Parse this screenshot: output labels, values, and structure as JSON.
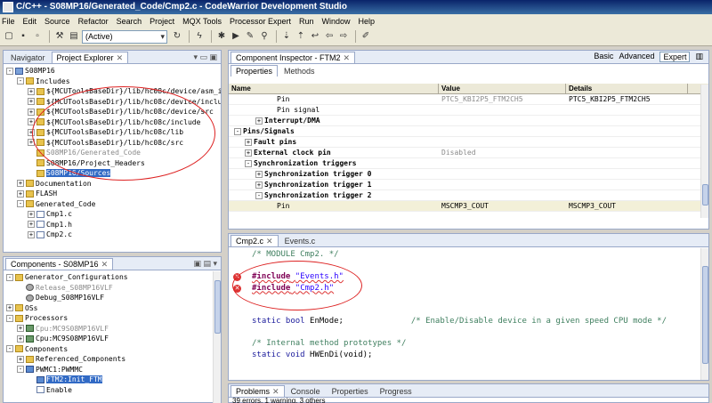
{
  "window": {
    "title": "C/C++ - S08MP16/Generated_Code/Cmp2.c - CodeWarrior Development Studio"
  },
  "menu": [
    "File",
    "Edit",
    "Source",
    "Refactor",
    "Search",
    "Project",
    "MQX Tools",
    "Processor Expert",
    "Run",
    "Window",
    "Help"
  ],
  "toolbar": {
    "config_combo": "(Active)"
  },
  "navigator": {
    "tabs": [
      "Navigator",
      "Project Explorer"
    ],
    "rows": [
      {
        "indent": 0,
        "toggle": "-",
        "icon": "proj",
        "label": "S08MP16"
      },
      {
        "indent": 1,
        "toggle": "-",
        "icon": "folder",
        "label": "Includes"
      },
      {
        "indent": 2,
        "toggle": "+",
        "icon": "folder",
        "label": "${MCUToolsBaseDir}/lib/hc08c/device/asm_in"
      },
      {
        "indent": 2,
        "toggle": "+",
        "icon": "folder",
        "label": "${MCUToolsBaseDir}/lib/hc08c/device/includ"
      },
      {
        "indent": 2,
        "toggle": "+",
        "icon": "folder",
        "label": "${MCUToolsBaseDir}/lib/hc08c/device/src"
      },
      {
        "indent": 2,
        "toggle": "+",
        "icon": "folder",
        "label": "${MCUToolsBaseDir}/lib/hc08c/include"
      },
      {
        "indent": 2,
        "toggle": "+",
        "icon": "folder",
        "label": "${MCUToolsBaseDir}/lib/hc08c/lib"
      },
      {
        "indent": 2,
        "toggle": "+",
        "icon": "folder",
        "label": "${MCUToolsBaseDir}/lib/hc08c/src"
      },
      {
        "indent": 2,
        "toggle": "",
        "icon": "folder",
        "label": "S08MP16/Generated_Code",
        "grey": true
      },
      {
        "indent": 2,
        "toggle": "",
        "icon": "folder",
        "label": "S08MP16/Project_Headers"
      },
      {
        "indent": 2,
        "toggle": "",
        "icon": "folder",
        "label": "S08MP16/Sources",
        "selected": true
      },
      {
        "indent": 1,
        "toggle": "+",
        "icon": "folder",
        "label": "Documentation"
      },
      {
        "indent": 1,
        "toggle": "+",
        "icon": "folder",
        "label": "FLASH"
      },
      {
        "indent": 1,
        "toggle": "-",
        "icon": "folder",
        "label": "Generated_Code"
      },
      {
        "indent": 2,
        "toggle": "+",
        "icon": "file",
        "label": "Cmp1.c"
      },
      {
        "indent": 2,
        "toggle": "+",
        "icon": "file",
        "label": "Cmp1.h"
      },
      {
        "indent": 2,
        "toggle": "+",
        "icon": "file",
        "label": "Cmp2.c"
      }
    ]
  },
  "components": {
    "tab": "Components - S08MP16",
    "rows": [
      {
        "indent": 0,
        "toggle": "-",
        "icon": "folder",
        "label": "Generator_Configurations"
      },
      {
        "indent": 1,
        "toggle": "",
        "icon": "gear",
        "label": "Release_S08MP16VLF",
        "grey": true
      },
      {
        "indent": 1,
        "toggle": "",
        "icon": "gear",
        "label": "Debug_S08MP16VLF"
      },
      {
        "indent": 0,
        "toggle": "+",
        "icon": "folder",
        "label": "OSs"
      },
      {
        "indent": 0,
        "toggle": "-",
        "icon": "folder",
        "label": "Processors"
      },
      {
        "indent": 1,
        "toggle": "+",
        "icon": "cpu",
        "label": "Cpu:MC9S08MP16VLF",
        "grey": true
      },
      {
        "indent": 1,
        "toggle": "+",
        "icon": "cpu",
        "label": "Cpu:MC9S08MP16VLF"
      },
      {
        "indent": 0,
        "toggle": "-",
        "icon": "folder",
        "label": "Components"
      },
      {
        "indent": 1,
        "toggle": "+",
        "icon": "folder",
        "label": "Referenced_Components"
      },
      {
        "indent": 1,
        "toggle": "-",
        "icon": "comp",
        "label": "PWMC1:PWMMC"
      },
      {
        "indent": 2,
        "toggle": "",
        "icon": "comp",
        "label": "FTM2:Init_FTM",
        "selected": true
      },
      {
        "indent": 2,
        "toggle": "",
        "icon": "file",
        "label": "Enable"
      }
    ]
  },
  "inspector": {
    "tab": "Component Inspector - FTM2",
    "subtabs": [
      "Properties",
      "Methods"
    ],
    "modes": [
      "Basic",
      "Advanced",
      "Expert"
    ],
    "columns": [
      "Name",
      "Value",
      "Details"
    ],
    "rows": [
      {
        "indent": 3,
        "toggle": "",
        "name": "Pin",
        "value": "PTC5_KBI2P5_FTM2CH5",
        "details": "PTC5_KBI2P5_FTM2CH5",
        "bold": false,
        "greyval": true
      },
      {
        "indent": 3,
        "toggle": "",
        "name": "Pin signal",
        "value": "",
        "details": "",
        "bold": false
      },
      {
        "indent": 2,
        "toggle": "+",
        "name": "Interrupt/DMA",
        "value": "",
        "details": "",
        "bold": true
      },
      {
        "indent": 0,
        "toggle": "-",
        "name": "Pins/Signals",
        "value": "",
        "details": "",
        "bold": true
      },
      {
        "indent": 1,
        "toggle": "+",
        "name": "Fault pins",
        "value": "",
        "details": "",
        "bold": true
      },
      {
        "indent": 1,
        "toggle": "+",
        "name": "External clock pin",
        "value": "Disabled",
        "details": "",
        "bold": true,
        "greyval": true
      },
      {
        "indent": 1,
        "toggle": "-",
        "name": "Synchronization triggers",
        "value": "",
        "details": "",
        "bold": true
      },
      {
        "indent": 2,
        "toggle": "+",
        "name": "Synchronization trigger 0",
        "value": "",
        "details": "",
        "bold": true
      },
      {
        "indent": 2,
        "toggle": "+",
        "name": "Synchronization trigger 1",
        "value": "",
        "details": "",
        "bold": true
      },
      {
        "indent": 2,
        "toggle": "-",
        "name": "Synchronization trigger 2",
        "value": "",
        "details": "",
        "bold": true
      },
      {
        "indent": 3,
        "toggle": "",
        "name": "Pin",
        "value": "MSCMP3_COUT",
        "details": "MSCMP3_COUT",
        "bold": false,
        "hl": true
      }
    ]
  },
  "editor": {
    "tabs": [
      "Cmp2.c",
      "Events.c"
    ],
    "lines": [
      {
        "type": "comment",
        "text": "/* MODULE Cmp2. */"
      },
      {
        "type": "blank",
        "text": ""
      },
      {
        "type": "include",
        "kw": "#include",
        "file": "\"Events.h\"",
        "error": true
      },
      {
        "type": "include",
        "kw": "#include",
        "file": "\"Cmp2.h\"",
        "error": true
      },
      {
        "type": "blank",
        "text": ""
      },
      {
        "type": "blank",
        "text": ""
      },
      {
        "type": "decl",
        "kw": "static bool",
        "rest": " EnMode;",
        "comment": "/* Enable/Disable device in a given speed CPU mode */"
      },
      {
        "type": "blank",
        "text": ""
      },
      {
        "type": "comment",
        "text": "/* Internal method prototypes */"
      },
      {
        "type": "decl",
        "kw": "static void",
        "rest": " HWEnDi(void);",
        "comment": ""
      }
    ]
  },
  "problems": {
    "tabs": [
      "Problems",
      "Console",
      "Properties",
      "Progress"
    ],
    "summary": "39 errors, 1 warning, 3 others"
  }
}
